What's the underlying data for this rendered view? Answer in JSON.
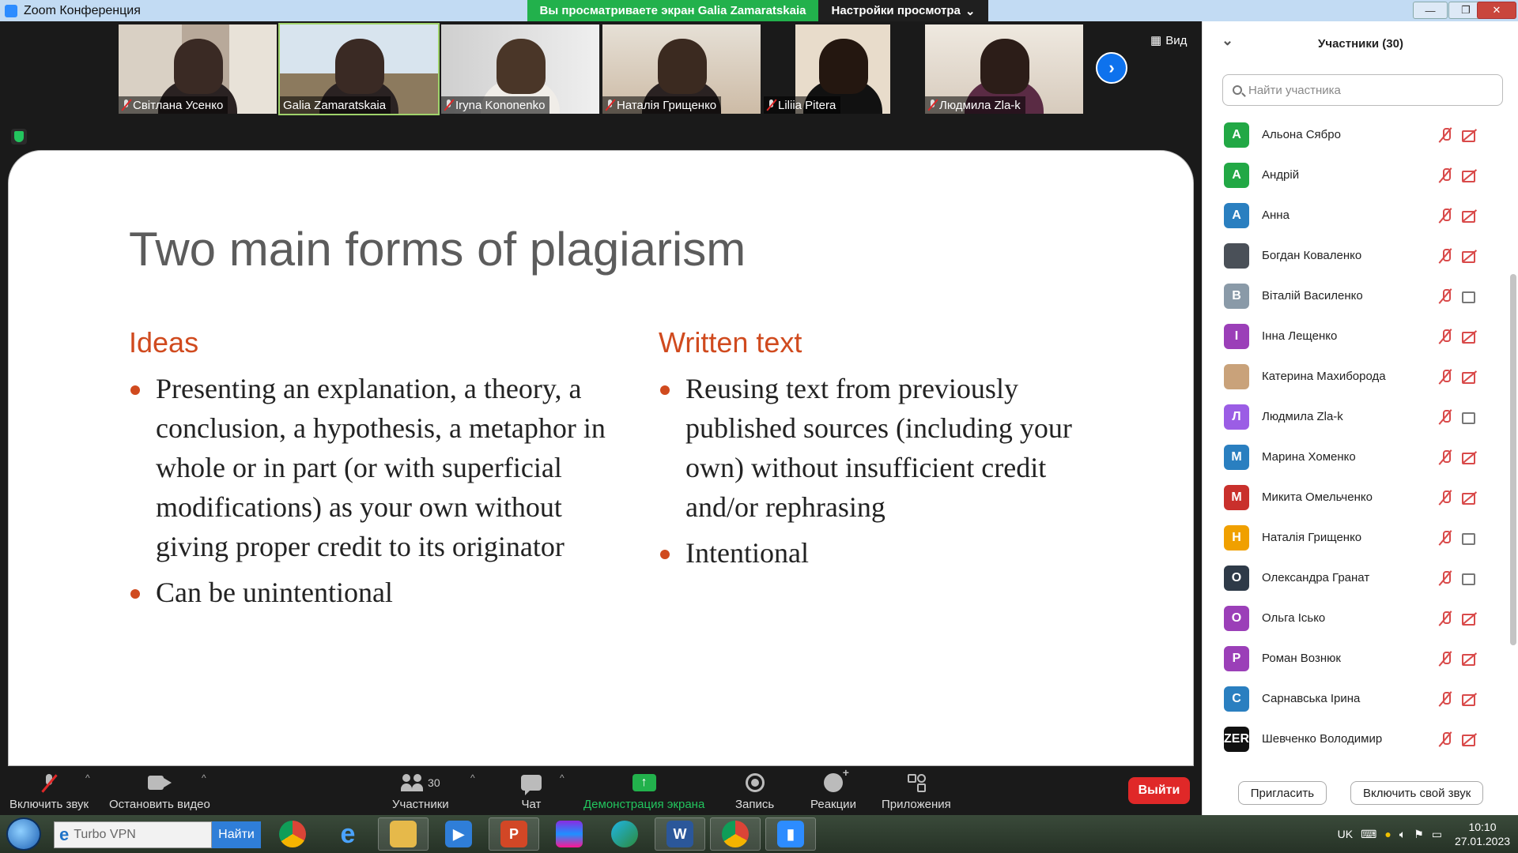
{
  "titlebar": {
    "title": "Zoom Конференция",
    "share_banner": "Вы просматриваете экран Galia Zamaratskaia",
    "view_options": "Настройки просмотра",
    "view_options_icon": "chevron-down-icon"
  },
  "video": {
    "tiles": [
      {
        "name": "Світлана Усенко",
        "muted": true,
        "active": false
      },
      {
        "name": "Galia Zamaratskaia",
        "muted": false,
        "active": true
      },
      {
        "name": "Iryna Kononenko",
        "muted": true,
        "active": false
      },
      {
        "name": "Наталія Грищенко",
        "muted": true,
        "active": false
      },
      {
        "name": "Liliia Pitera",
        "muted": true,
        "active": false
      },
      {
        "name": "Людмила Zla-k",
        "muted": true,
        "active": false
      }
    ],
    "view_label": "Вид"
  },
  "slide": {
    "title": "Two main forms of plagiarism",
    "left": {
      "heading": "Ideas",
      "bullets": [
        "Presenting an explanation, a theory, a conclusion, a hypothesis, a metaphor in whole or in part (or with superficial modifications) as your own without giving proper credit to its originator",
        "Can be unintentional"
      ]
    },
    "right": {
      "heading": "Written text",
      "bullets": [
        "Reusing text from previously published sources (including your own) without insufficient credit and/or rephrasing",
        "Intentional"
      ]
    },
    "accent_color": "#d04a1e"
  },
  "participants": {
    "header": "Участники (30)",
    "search_placeholder": "Найти участника",
    "list": [
      {
        "initial": "А",
        "name": "Альона Сябро",
        "color": "#22a845",
        "video_on": false
      },
      {
        "initial": "А",
        "name": "Андрій",
        "color": "#22a845",
        "video_on": false
      },
      {
        "initial": "А",
        "name": "Анна",
        "color": "#2a7fc0",
        "video_on": false
      },
      {
        "initial": "",
        "name": "Богдан Коваленко",
        "color": "#4a5058",
        "video_on": false
      },
      {
        "initial": "В",
        "name": "Віталій Василенко",
        "color": "#8a9aa8",
        "video_on": true
      },
      {
        "initial": "I",
        "name": "Інна Лещенко",
        "color": "#9b3fb8",
        "video_on": false
      },
      {
        "initial": "",
        "name": "Катерина Махиборода",
        "color": "#c9a27a",
        "video_on": false
      },
      {
        "initial": "Л",
        "name": "Людмила Zla-k",
        "color": "#9b5de5",
        "video_on": true
      },
      {
        "initial": "М",
        "name": "Марина Хоменко",
        "color": "#2a7fc0",
        "video_on": false
      },
      {
        "initial": "М",
        "name": "Микита Омельченко",
        "color": "#c9302c",
        "video_on": false
      },
      {
        "initial": "Н",
        "name": "Наталія Грищенко",
        "color": "#f0a000",
        "video_on": true
      },
      {
        "initial": "О",
        "name": "Олександра Гранат",
        "color": "#2e3a48",
        "video_on": true
      },
      {
        "initial": "О",
        "name": "Ольга Ісько",
        "color": "#9b3fb8",
        "video_on": false
      },
      {
        "initial": "Р",
        "name": "Роман Вознюк",
        "color": "#9b3fb8",
        "video_on": false
      },
      {
        "initial": "С",
        "name": "Сарнавська Ірина",
        "color": "#2a7fc0",
        "video_on": false
      },
      {
        "initial": "ZER",
        "name": "Шевченко Володимир",
        "color": "#111111",
        "video_on": false
      }
    ],
    "invite_label": "Пригласить",
    "unmute_me_label": "Включить свой звук"
  },
  "toolbar": {
    "audio_label": "Включить звук",
    "video_label": "Остановить видео",
    "participants_label": "Участники",
    "participants_count": "30",
    "chat_label": "Чат",
    "share_label": "Демонстрация экрана",
    "record_label": "Запись",
    "reactions_label": "Реакции",
    "apps_label": "Приложения",
    "leave_label": "Выйти"
  },
  "taskbar": {
    "search_value": "Turbo VPN",
    "search_button": "Найти",
    "lang": "UK",
    "time": "10:10",
    "date": "27.01.2023"
  }
}
